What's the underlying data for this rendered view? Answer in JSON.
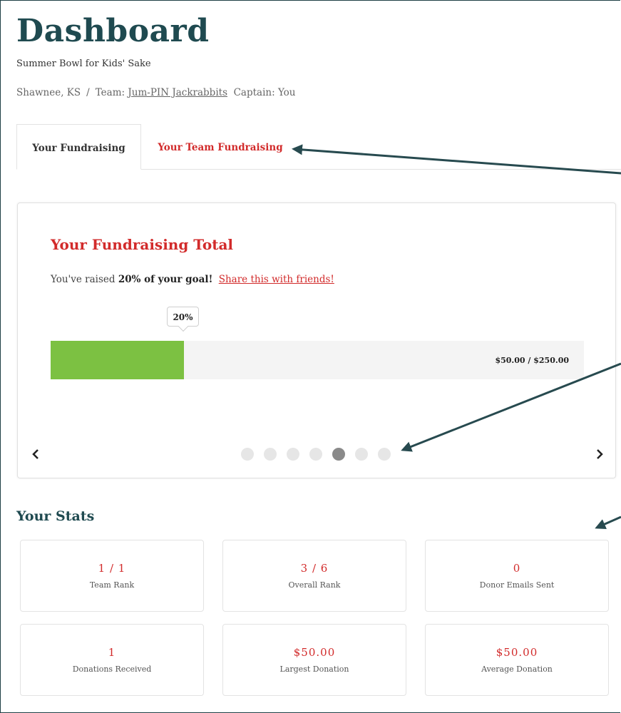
{
  "header": {
    "title": "Dashboard",
    "event_name": "Summer Bowl for Kids' Sake",
    "location": "Shawnee, KS",
    "separator": "/",
    "team_label": "Team:",
    "team_name": "Jum-PIN Jackrabbits",
    "captain_label": "Captain: You"
  },
  "tabs": [
    {
      "label": "Your Fundraising",
      "active": true
    },
    {
      "label": "Your Team Fundraising",
      "active": false
    }
  ],
  "fundraising": {
    "title": "Your Fundraising Total",
    "raised_prefix": "You've raised",
    "raised_strong": "20% of your goal!",
    "share_link": "Share this with friends!",
    "progress_label": "20%",
    "progress_fraction": 0.2,
    "amount_text": "$50.00 / $250.00"
  },
  "carousel": {
    "dot_count": 7,
    "active_index": 4
  },
  "stats": {
    "title": "Your Stats",
    "items": [
      {
        "value": "1 / 1",
        "label": "Team Rank"
      },
      {
        "value": "3 / 6",
        "label": "Overall Rank"
      },
      {
        "value": "0",
        "label": "Donor Emails Sent"
      },
      {
        "value": "1",
        "label": "Donations Received"
      },
      {
        "value": "$50.00",
        "label": "Largest Donation"
      },
      {
        "value": "$50.00",
        "label": "Average Donation"
      }
    ]
  },
  "colors": {
    "brand_dark": "#1f4a50",
    "accent_red": "#d22b2b",
    "progress_green": "#7cc142",
    "annotation_arrow": "#274a4f"
  }
}
